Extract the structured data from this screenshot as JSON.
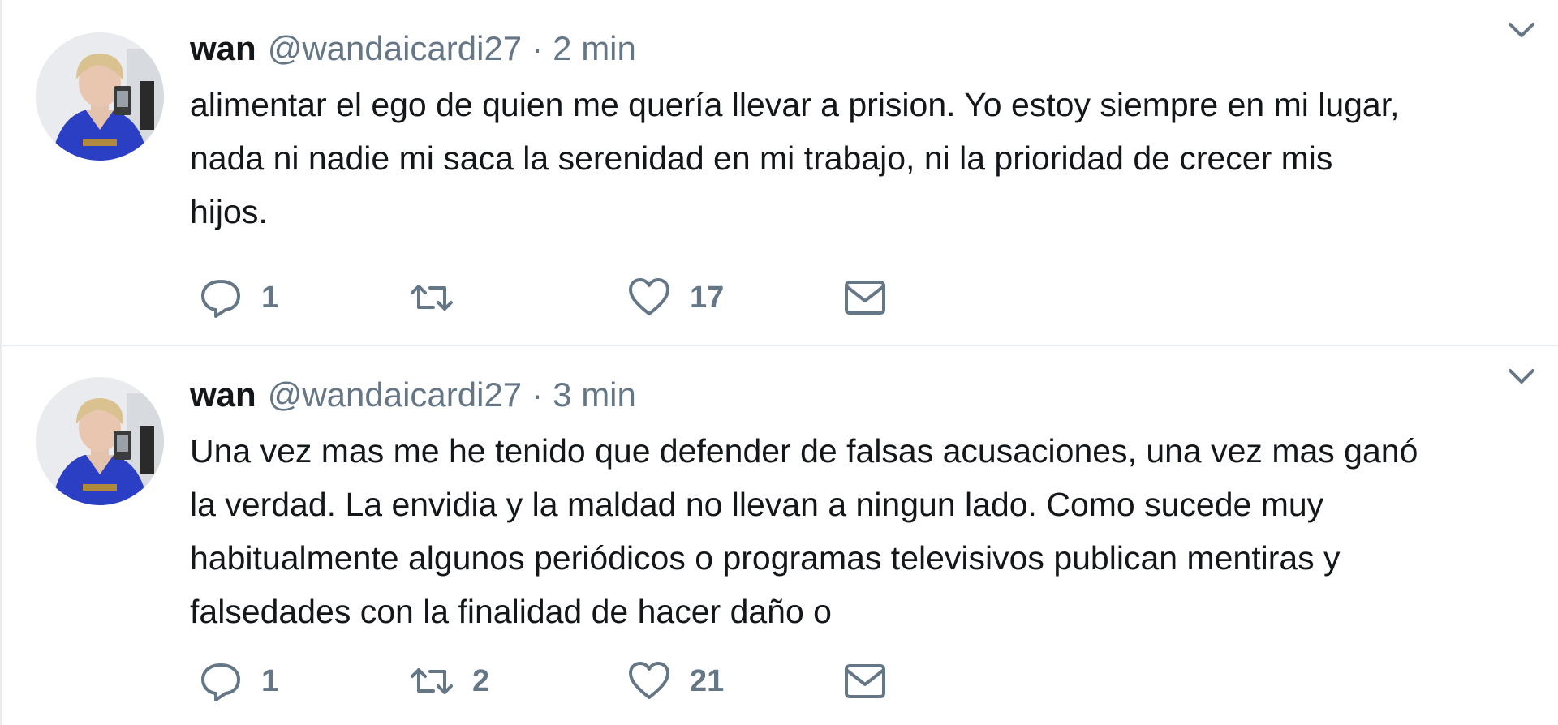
{
  "tweets": [
    {
      "name": "wan",
      "handle": "@wandaicardi27",
      "separator": "·",
      "time": "2 min",
      "text_lines": [
        "alimentar el ego de quien me quería llevar a prision. Yo estoy siempre en mi lugar,",
        "nada ni nadie mi saca la serenidad en mi trabajo, ni la prioridad de crecer mis",
        "hijos."
      ],
      "reply_count": "1",
      "retweet_count": "",
      "like_count": "17",
      "icons": {
        "reply": "reply-icon",
        "retweet": "retweet-icon",
        "like": "heart-icon",
        "dm": "envelope-icon",
        "caret": "chevron-down-icon"
      }
    },
    {
      "name": "wan",
      "handle": "@wandaicardi27",
      "separator": "·",
      "time": "3 min",
      "text_lines": [
        "Una vez mas me he tenido que defender de falsas acusaciones, una vez mas ganó",
        "la verdad. La envidia y la maldad no llevan a ningun lado. Como sucede muy",
        "habitualmente algunos periódicos o programas televisivos publican mentiras y",
        "falsedades con la finalidad de hacer daño o"
      ],
      "reply_count": "1",
      "retweet_count": "2",
      "like_count": "21",
      "icons": {
        "reply": "reply-icon",
        "retweet": "retweet-icon",
        "like": "heart-icon",
        "dm": "envelope-icon",
        "caret": "chevron-down-icon"
      }
    }
  ],
  "colors": {
    "text_primary": "#14171a",
    "text_secondary": "#657786",
    "divider": "#e6ecf0",
    "avatar_outfit": "#2b3fc4",
    "background": "#ffffff"
  }
}
